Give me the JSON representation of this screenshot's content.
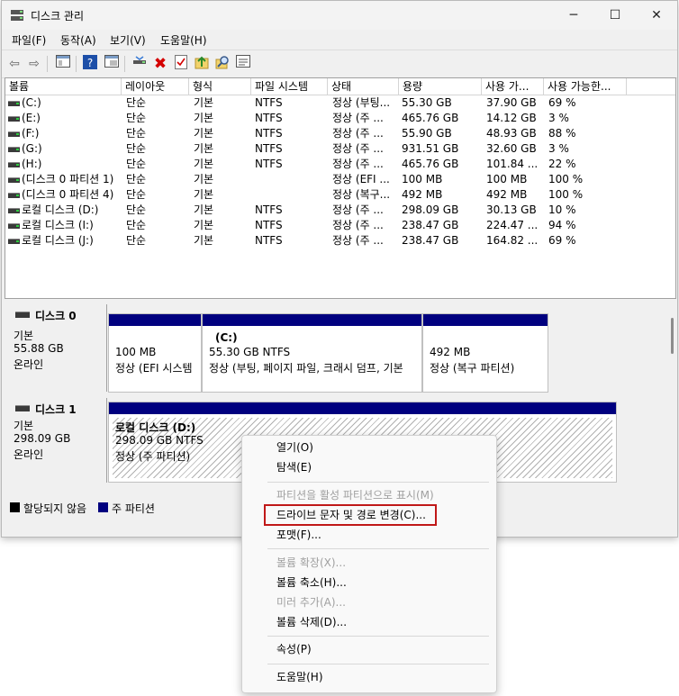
{
  "window": {
    "title": "디스크 관리",
    "minimize": "─",
    "maximize": "☐",
    "close": "✕"
  },
  "menubar": {
    "items": [
      "파일(F)",
      "동작(A)",
      "보기(V)",
      "도움말(H)"
    ]
  },
  "toolbar": {
    "icons": [
      "back-icon",
      "forward-icon",
      "console-icon",
      "help-icon",
      "properties-icon",
      "connect-icon",
      "delete-icon",
      "check-icon",
      "refresh-icon",
      "search-icon",
      "view-icon"
    ]
  },
  "volume_list": {
    "columns": [
      "볼륨",
      "레이아웃",
      "형식",
      "파일 시스템",
      "상태",
      "용량",
      "사용 가...",
      "사용 가능한..."
    ],
    "rows": [
      [
        "(C:)",
        "단순",
        "기본",
        "NTFS",
        "정상 (부팅...",
        "55.30 GB",
        "37.90 GB",
        "69 %"
      ],
      [
        "(E:)",
        "단순",
        "기본",
        "NTFS",
        "정상 (주 ...",
        "465.76 GB",
        "14.12 GB",
        "3 %"
      ],
      [
        "(F:)",
        "단순",
        "기본",
        "NTFS",
        "정상 (주 ...",
        "55.90 GB",
        "48.93 GB",
        "88 %"
      ],
      [
        "(G:)",
        "단순",
        "기본",
        "NTFS",
        "정상 (주 ...",
        "931.51 GB",
        "32.60 GB",
        "3 %"
      ],
      [
        "(H:)",
        "단순",
        "기본",
        "NTFS",
        "정상 (주 ...",
        "465.76 GB",
        "101.84 ...",
        "22 %"
      ],
      [
        "(디스크 0 파티션 1)",
        "단순",
        "기본",
        "",
        "정상 (EFI ...",
        "100 MB",
        "100 MB",
        "100 %"
      ],
      [
        "(디스크 0 파티션 4)",
        "단순",
        "기본",
        "",
        "정상 (복구...",
        "492 MB",
        "492 MB",
        "100 %"
      ],
      [
        "로컬 디스크 (D:)",
        "단순",
        "기본",
        "NTFS",
        "정상 (주 ...",
        "298.09 GB",
        "30.13 GB",
        "10 %"
      ],
      [
        "로컬 디스크 (I:)",
        "단순",
        "기본",
        "NTFS",
        "정상 (주 ...",
        "238.47 GB",
        "224.47 ...",
        "94 %"
      ],
      [
        "로컬 디스크 (J:)",
        "단순",
        "기본",
        "NTFS",
        "정상 (주 ...",
        "238.47 GB",
        "164.82 ...",
        "69 %"
      ]
    ]
  },
  "disks": [
    {
      "name": "디스크 0",
      "type": "기본",
      "size": "55.88 GB",
      "status": "온라인",
      "partitions": [
        {
          "label": "",
          "size": "100 MB",
          "status": "정상 (EFI 시스템"
        },
        {
          "label": "(C:)",
          "size": "55.30 GB NTFS",
          "status": "정상 (부팅, 페이지 파일, 크래시 덤프, 기본"
        },
        {
          "label": "",
          "size": "492 MB",
          "status": "정상 (복구 파티션)"
        }
      ]
    },
    {
      "name": "디스크 1",
      "type": "기본",
      "size": "298.09 GB",
      "status": "온라인",
      "partitions": [
        {
          "label": "로컬 디스크  (D:)",
          "size": "298.09 GB NTFS",
          "status": "정상 (주 파티션)"
        }
      ]
    }
  ],
  "legend": {
    "unallocated": "할당되지 않음",
    "primary": "주 파티션",
    "unallocated_color": "#000000",
    "primary_color": "#00007f"
  },
  "context_menu": {
    "open": "열기(O)",
    "explore": "탐색(E)",
    "mark_active": "파티션을 활성 파티션으로 표시(M)",
    "change_letter": "드라이브 문자 및 경로 변경(C)...",
    "format": "포맷(F)...",
    "extend": "볼륨 확장(X)...",
    "shrink": "볼륨 축소(H)...",
    "add_mirror": "미러 추가(A)...",
    "delete": "볼륨 삭제(D)...",
    "properties": "속성(P)",
    "help": "도움말(H)"
  }
}
